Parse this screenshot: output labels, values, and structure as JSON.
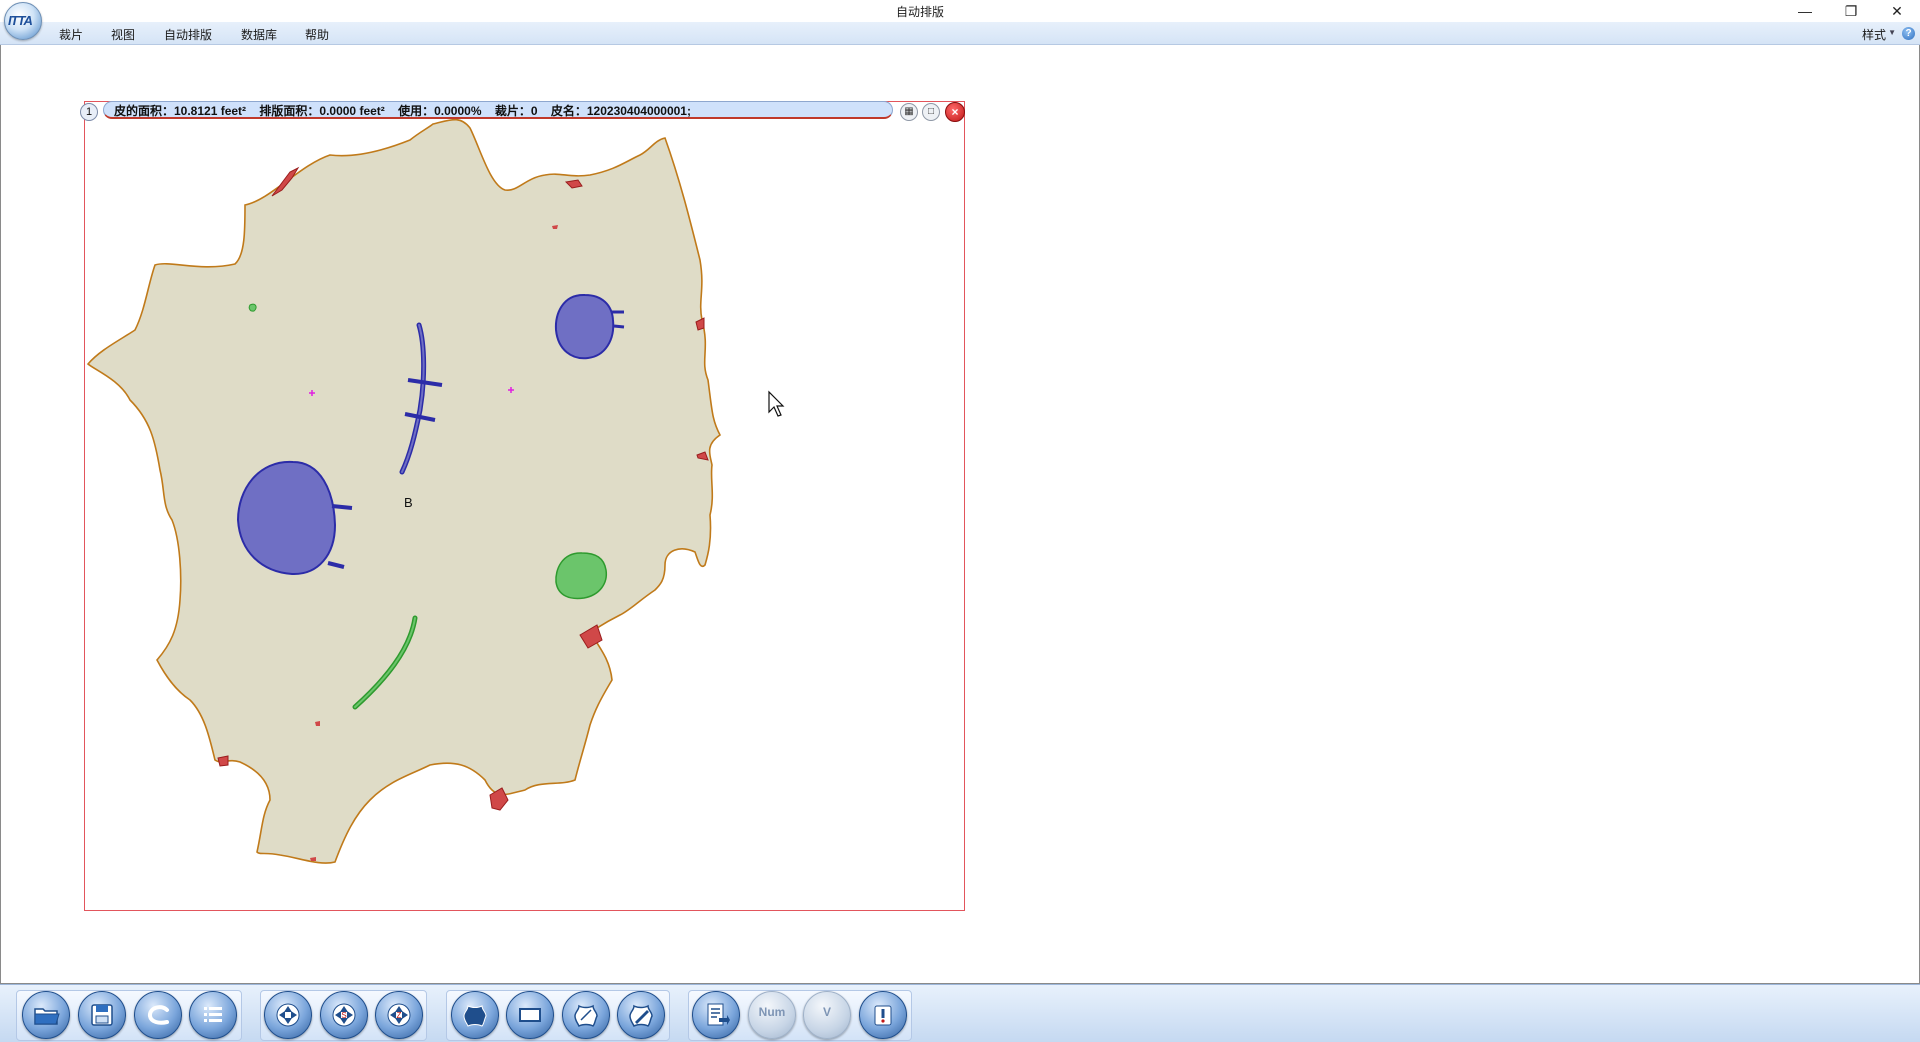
{
  "app": {
    "logo_text": "ITTA",
    "title": "自动排版",
    "window_controls": [
      "minimize",
      "restore",
      "close"
    ]
  },
  "menu": {
    "items": [
      "裁片",
      "视图",
      "自动排版",
      "数据库",
      "帮助"
    ],
    "style_label": "样式",
    "help_icon": "?"
  },
  "hide_panel": {
    "index": "1",
    "info": {
      "hide_area": "皮的面积：10.8121 feet²",
      "nest_area": "排版面积：0.0000 feet²",
      "usage": "使用：0.0000%",
      "pieces": "裁片：0",
      "hide_name": "皮名：120230404000001;"
    },
    "label_b": "B",
    "close_icon": "×"
  },
  "colors": {
    "hide_fill": "#dfdcc7",
    "hide_outline": "#c07a1a",
    "defect_blue": "#6f6fc4",
    "defect_blue_stroke": "#2c2ca8",
    "defect_green": "#6bc56b",
    "defect_green_stroke": "#2e9a2e",
    "defect_red": "#d04848",
    "panel_border": "#e2555c"
  },
  "toolbar": {
    "groups": [
      [
        "open-folder-icon",
        "save-icon",
        "import-hide-icon",
        "list-icon"
      ],
      [
        "auto-nest-icon",
        "nest-s-icon",
        "nest-z-icon"
      ],
      [
        "hide-shape-icon",
        "rectangle-icon",
        "hide-scan-icon",
        "hide-edit-icon"
      ],
      [
        "report-icon",
        "num-icon",
        "v-icon",
        "export-icon"
      ]
    ],
    "num_label": "Num",
    "v_label": "V"
  }
}
